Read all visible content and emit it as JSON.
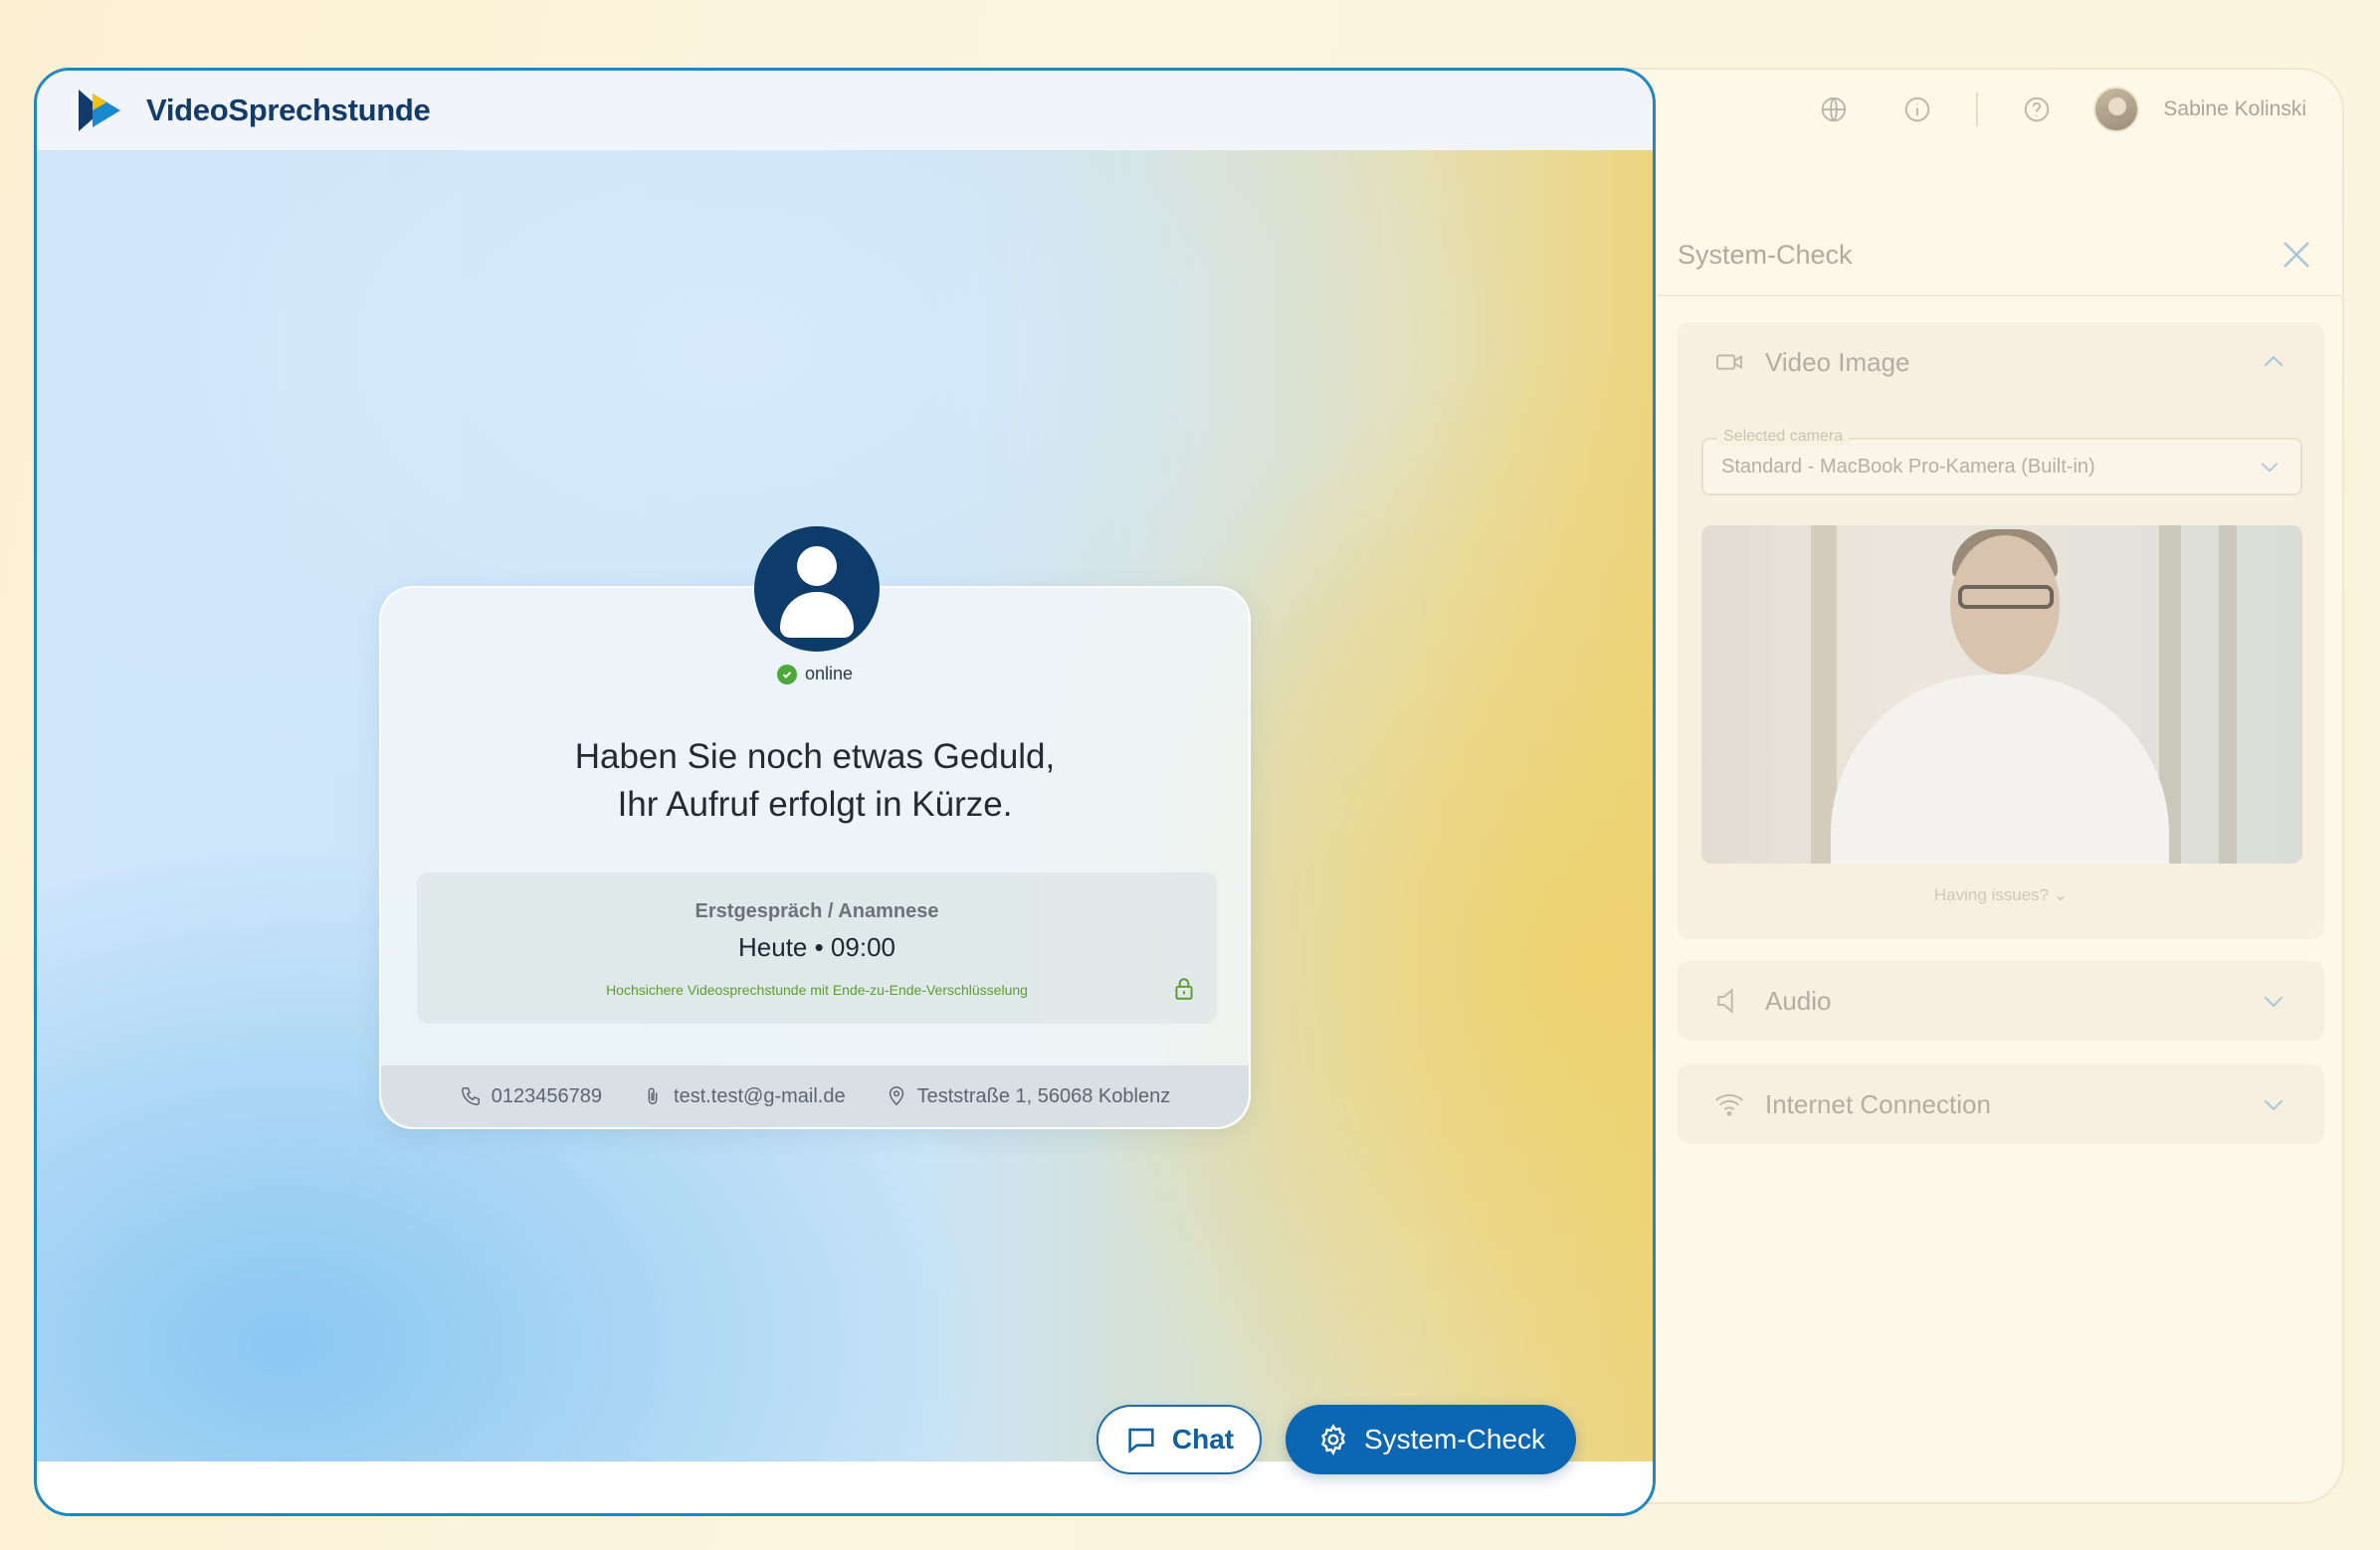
{
  "app": {
    "brand": "VideoSprechstunde"
  },
  "user": {
    "name": "Sabine Kolinski"
  },
  "waiting": {
    "status": "online",
    "headline_line1": "Haben Sie noch etwas Geduld,",
    "headline_line2": "Ihr Aufruf erfolgt in Kürze.",
    "appointment_type": "Erstgespräch / Anamnese",
    "appointment_time": "Heute • 09:00",
    "security_note": "Hochsichere Videosprechstunde mit Ende-zu-Ende-Verschlüsselung",
    "phone": "0123456789",
    "email": "test.test@g-mail.de",
    "address": "Teststraße 1, 56068 Koblenz"
  },
  "actions": {
    "chat_label": "Chat",
    "system_check_label": "System-Check"
  },
  "system_check": {
    "title": "System-Check",
    "video": {
      "label": "Video Image",
      "camera_legend": "Selected camera",
      "camera_value": "Standard - MacBook Pro-Kamera (Built-in)",
      "issues": "Having issues?"
    },
    "audio": {
      "label": "Audio"
    },
    "internet": {
      "label": "Internet Connection"
    }
  },
  "colors": {
    "primary": "#0b67b3",
    "brand_dark": "#123a6b",
    "online": "#4ca838"
  }
}
